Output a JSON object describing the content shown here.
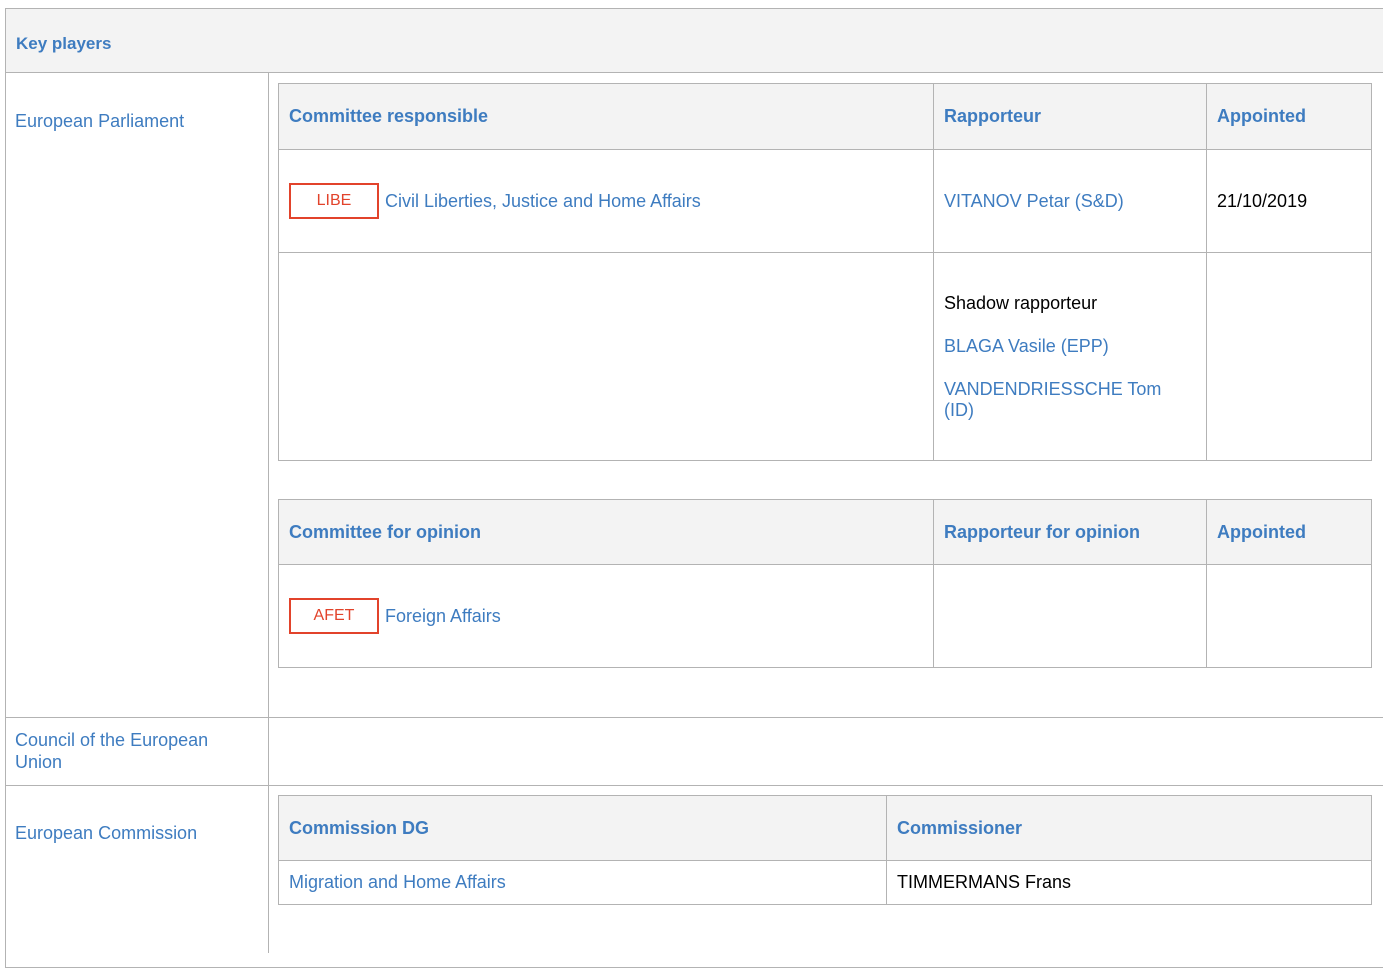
{
  "title": "Key players",
  "sections": {
    "ep": "European Parliament",
    "council": "Council of the European Union",
    "commission": "European Commission"
  },
  "responsible": {
    "headers": {
      "committee": "Committee responsible",
      "rapporteur": "Rapporteur",
      "appointed": "Appointed"
    },
    "row": {
      "abbr": "LIBE",
      "name": "Civil Liberties, Justice and Home Affairs",
      "rapporteur": "VITANOV Petar (S&D)",
      "appointed": "21/10/2019"
    },
    "shadow": {
      "label": "Shadow rapporteur",
      "names": [
        "BLAGA Vasile (EPP)",
        "VANDENDRIESSCHE Tom (ID)"
      ]
    }
  },
  "opinion": {
    "headers": {
      "committee": "Committee for opinion",
      "rapporteur": "Rapporteur for opinion",
      "appointed": "Appointed"
    },
    "row": {
      "abbr": "AFET",
      "name": "Foreign Affairs"
    }
  },
  "commission": {
    "headers": {
      "dg": "Commission DG",
      "commissioner": "Commissioner"
    },
    "row": {
      "dg": "Migration and Home Affairs",
      "commissioner": "TIMMERMANS Frans"
    }
  },
  "colors": {
    "link": "#3e7cc0",
    "badge": "#e2432b",
    "header_bg": "#f3f3f3",
    "border": "#b3b3b3"
  }
}
